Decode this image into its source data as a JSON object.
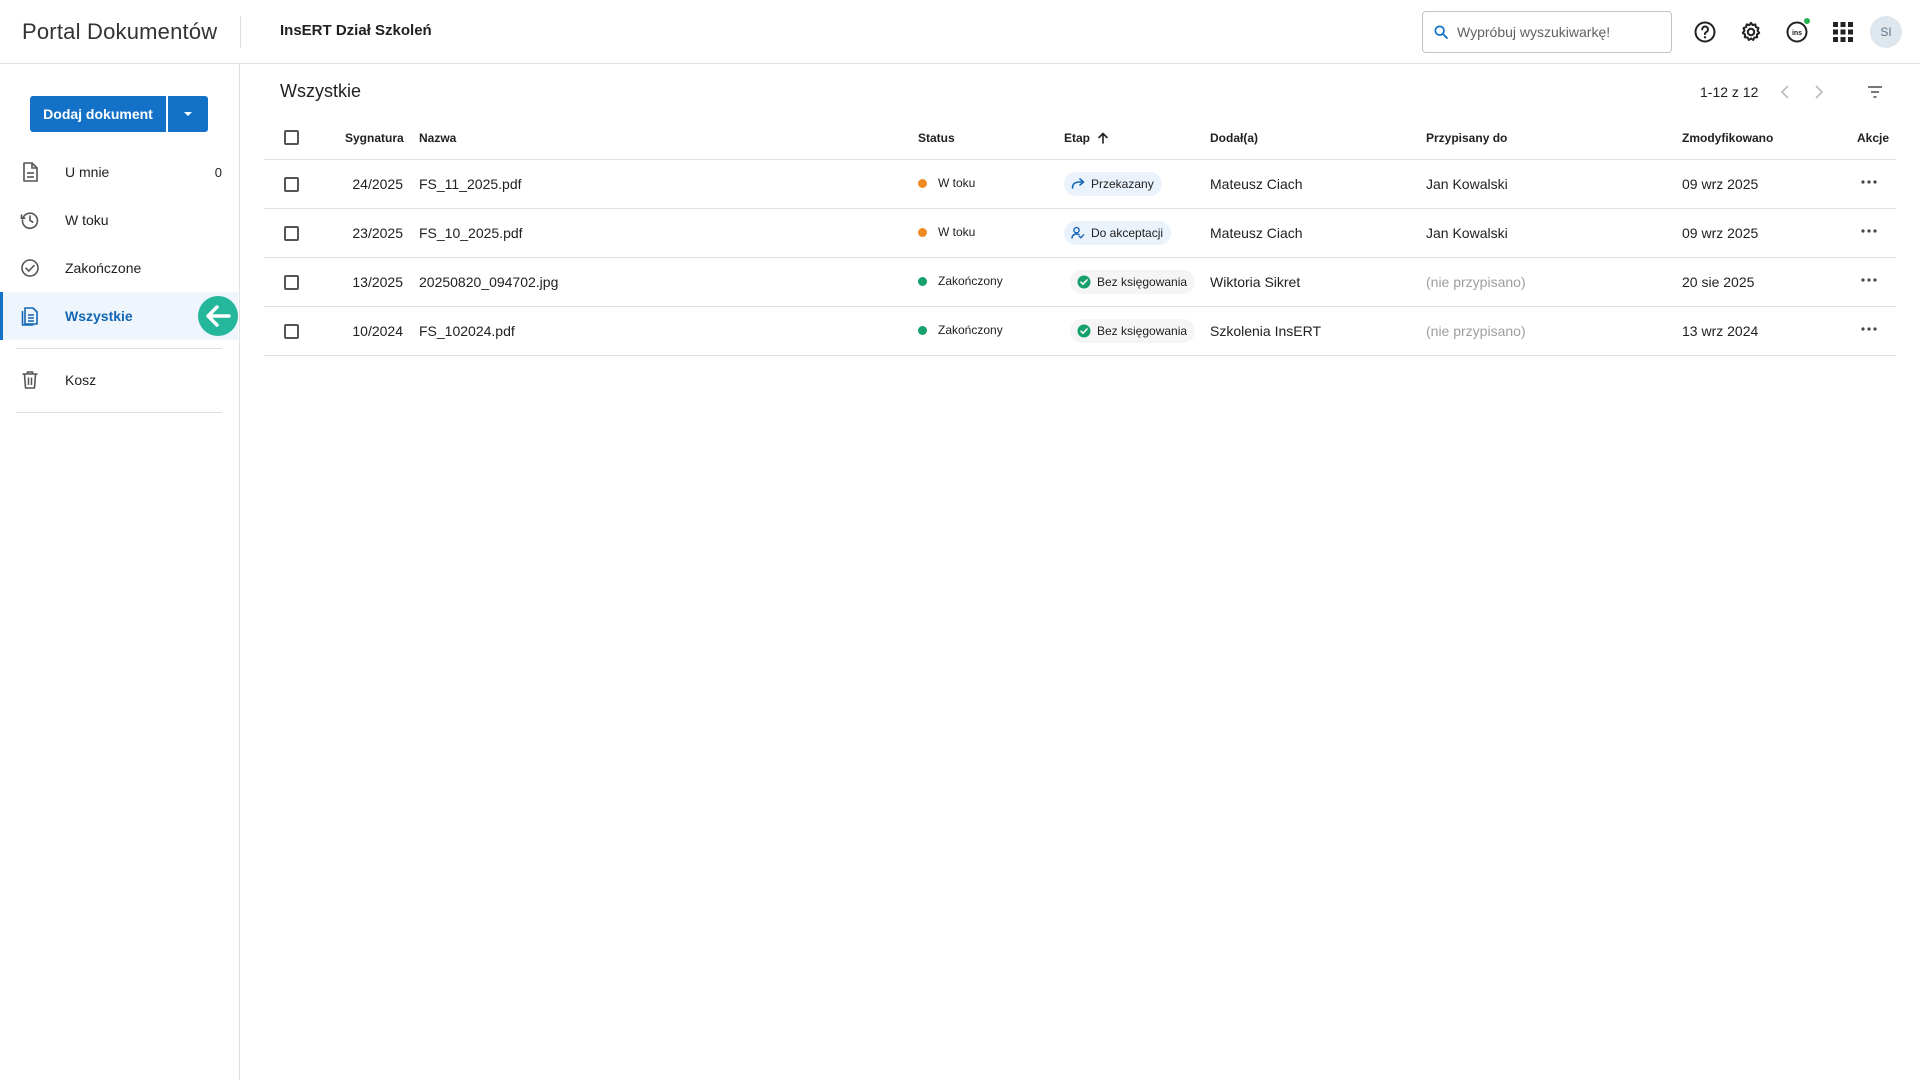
{
  "header": {
    "app_title": "Portal Dokumentów",
    "org_name": "InsERT Dział Szkoleń",
    "search_placeholder": "Wypróbuj wyszukiwarkę!",
    "avatar_initials": "SI",
    "icons": [
      "help-icon",
      "settings-icon",
      "insert-app-icon",
      "apps-grid-icon"
    ],
    "status_color": "#22b04b"
  },
  "sidebar": {
    "add_button_label": "Dodaj dokument",
    "accent_color": "#1372c8",
    "items": [
      {
        "label": "U mnie",
        "count": "0",
        "icon": "document-icon"
      },
      {
        "label": "W toku",
        "icon": "history-icon"
      },
      {
        "label": "Zakończone",
        "icon": "check-circle-icon"
      },
      {
        "label": "Wszystkie",
        "icon": "documents-icon",
        "active": true
      },
      {
        "label": "Kosz",
        "icon": "trash-icon"
      }
    ]
  },
  "main": {
    "title": "Wszystkie",
    "pagination": "1-12 z 12",
    "columns": {
      "signature": "Sygnatura",
      "name": "Nazwa",
      "status": "Status",
      "stage": "Etap",
      "added_by": "Dodał(a)",
      "assigned_to": "Przypisany do",
      "modified": "Zmodyfikowano",
      "actions": "Akcje"
    },
    "rows": [
      {
        "signature": "24/2025",
        "name": "FS_11_2025.pdf",
        "status": "W toku",
        "status_color": "#f08a24",
        "stage": "Przekazany",
        "stage_icon": "forward-arrow-icon",
        "added_by": "Mateusz Ciach",
        "assigned_to": "Jan Kowalski",
        "modified": "09 wrz 2025"
      },
      {
        "signature": "23/2025",
        "name": "FS_10_2025.pdf",
        "status": "W toku",
        "status_color": "#f08a24",
        "stage": "Do akceptacji",
        "stage_icon": "person-check-icon",
        "added_by": "Mateusz Ciach",
        "assigned_to": "Jan Kowalski",
        "modified": "09 wrz 2025"
      },
      {
        "signature": "13/2025",
        "name": "20250820_094702.jpg",
        "status": "Zakończony",
        "status_color": "#16a06b",
        "stage": "Bez księgowania",
        "stage_icon": "check-circle-filled-icon",
        "added_by": "Wiktoria Sikret",
        "assigned_to": "(nie przypisano)",
        "modified": "20 sie 2025"
      },
      {
        "signature": "10/2024",
        "name": "FS_102024.pdf",
        "status": "Zakończony",
        "status_color": "#16a06b",
        "stage": "Bez księgowania",
        "stage_icon": "check-circle-filled-icon",
        "added_by": "Szkolenia InsERT",
        "assigned_to": "(nie przypisano)",
        "modified": "13 wrz 2024"
      }
    ]
  }
}
